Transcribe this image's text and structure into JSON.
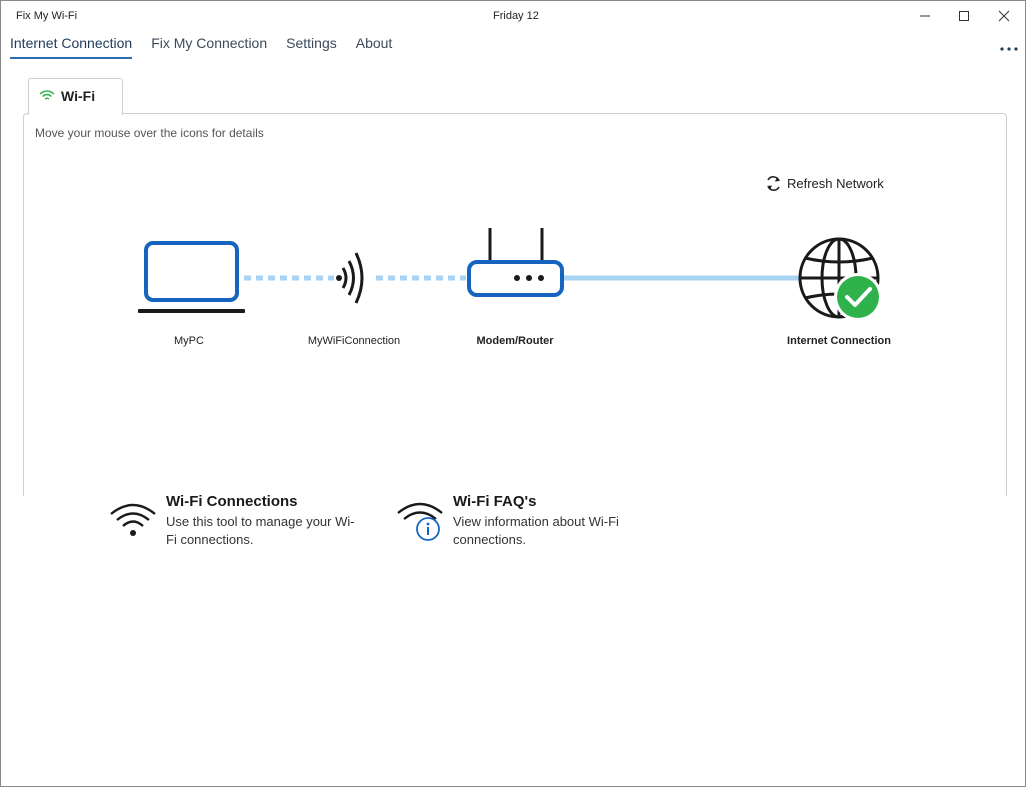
{
  "window": {
    "app_title": "Fix My Wi-Fi",
    "center_title": "Friday 12"
  },
  "nav": {
    "tabs": [
      {
        "label": "Internet Connection",
        "active": true
      },
      {
        "label": "Fix My Connection",
        "active": false
      },
      {
        "label": "Settings",
        "active": false
      },
      {
        "label": "About",
        "active": false
      }
    ]
  },
  "wifi_tab": {
    "label": "Wi-Fi",
    "icon": "wifi-icon",
    "icon_color": "#2fb24c"
  },
  "panel": {
    "hint": "Move your mouse over the icons for details",
    "refresh_label": "Refresh Network",
    "nodes": {
      "pc": "MyPC",
      "connection": "MyWiFiConnection",
      "router": "Modem/Router",
      "internet": "Internet Connection"
    },
    "status_color": "#2fb24c",
    "accent_color": "#1565c0",
    "link_color": "#a9d3f3"
  },
  "cards": {
    "connections": {
      "title": "Wi-Fi Connections",
      "description": "Use this tool to manage your Wi-Fi connections."
    },
    "faq": {
      "title": "Wi-Fi FAQ's",
      "description": "View information about Wi-Fi connections."
    }
  }
}
